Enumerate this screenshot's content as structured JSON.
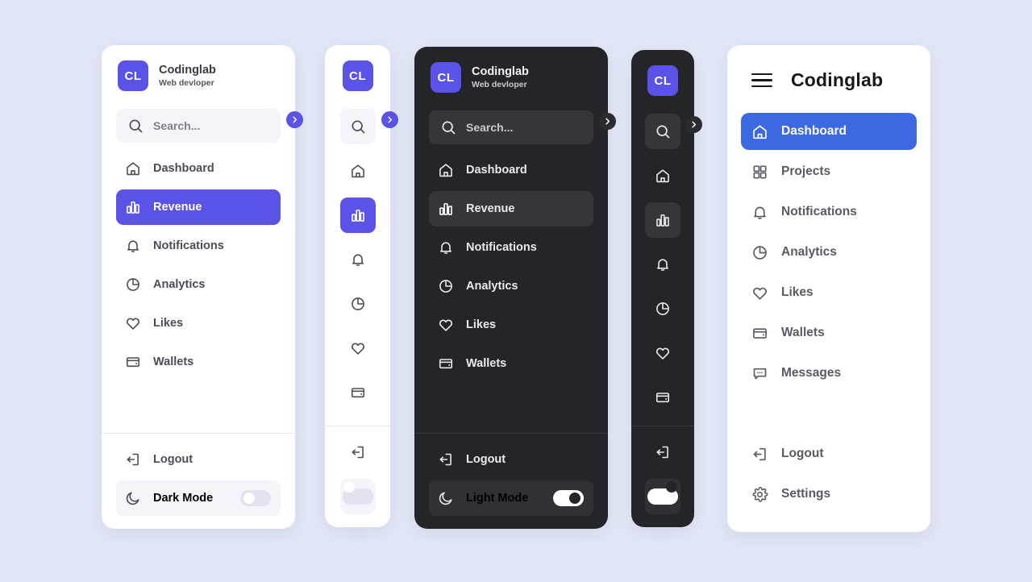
{
  "page": {
    "background_color": "#e2e7f6",
    "accent_purple": "#5b52e8",
    "accent_blue": "#3c68e2",
    "dark_panel_color": "#242529"
  },
  "brand": {
    "logo_text": "CL",
    "name": "Codinglab",
    "subtitle": "Web devloper"
  },
  "search": {
    "placeholder": "Search...",
    "text": "Search..."
  },
  "nav_items": [
    {
      "label": "Dashboard",
      "icon": "home-icon"
    },
    {
      "label": "Revenue",
      "icon": "bar-chart-icon"
    },
    {
      "label": "Notifications",
      "icon": "bell-icon"
    },
    {
      "label": "Analytics",
      "icon": "pie-chart-icon"
    },
    {
      "label": "Likes",
      "icon": "heart-icon"
    },
    {
      "label": "Wallets",
      "icon": "wallet-icon"
    }
  ],
  "logout": {
    "label": "Logout",
    "icon": "logout-icon"
  },
  "mode": {
    "light_panel_label": "Dark Mode",
    "dark_panel_label": "Light Mode",
    "icon": "moon-icon",
    "light_panel_toggle": "off",
    "dark_panel_toggle": "on"
  },
  "right_panel": {
    "menu_icon": "hamburger-icon",
    "title": "Codinglab",
    "items": [
      {
        "label": "Dashboard",
        "icon": "home-icon",
        "active": true
      },
      {
        "label": "Projects",
        "icon": "grid-icon",
        "active": false
      },
      {
        "label": "Notifications",
        "icon": "bell-icon",
        "active": false
      },
      {
        "label": "Analytics",
        "icon": "pie-chart-icon",
        "active": false
      },
      {
        "label": "Likes",
        "icon": "heart-icon",
        "active": false
      },
      {
        "label": "Wallets",
        "icon": "wallet-icon",
        "active": false
      },
      {
        "label": "Messages",
        "icon": "message-icon",
        "active": false
      }
    ],
    "footer": [
      {
        "label": "Logout",
        "icon": "logout-icon"
      },
      {
        "label": "Settings",
        "icon": "gear-icon"
      }
    ]
  },
  "toggle_arrow": {
    "icon": "chevron-right-icon"
  }
}
